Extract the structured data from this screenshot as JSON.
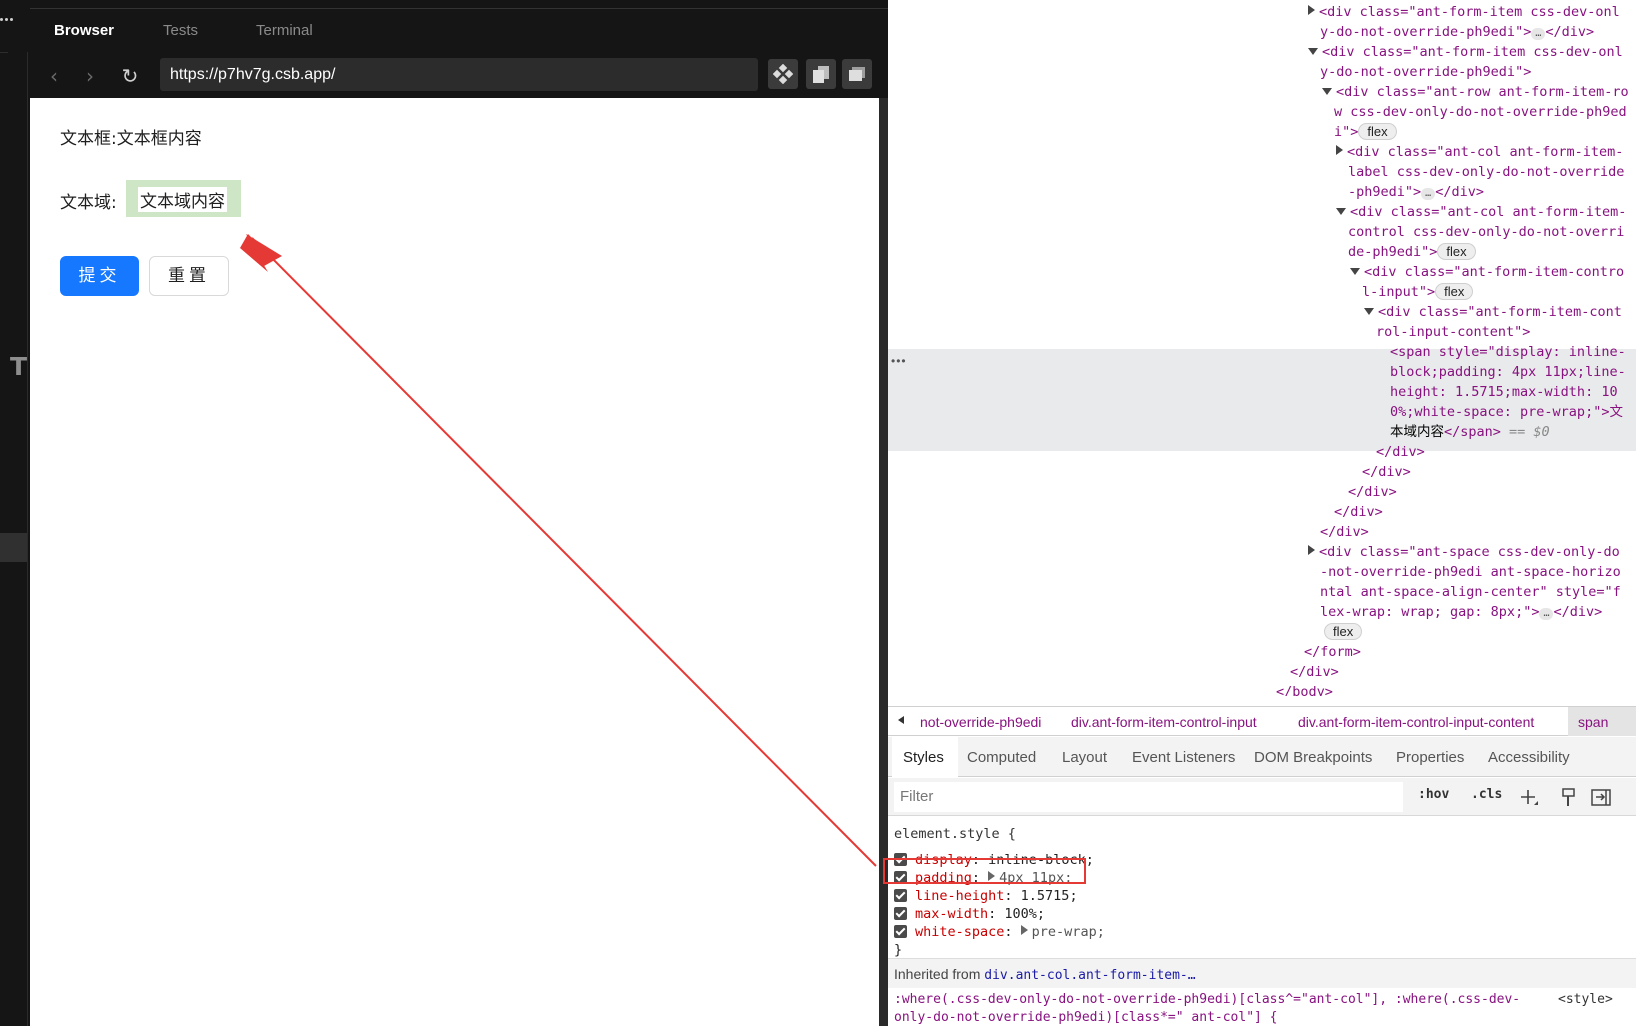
{
  "browser": {
    "tabs": [
      "Browser",
      "Tests",
      "Terminal"
    ],
    "url": "https://p7hv7g.csb.app/",
    "sidebar_letter": "T"
  },
  "form": {
    "input_label": "文本框:",
    "input_value": "文本框内容",
    "textarea_label": "文本域:",
    "textarea_value": "文本域内容",
    "submit_label": "提交",
    "reset_label": "重置"
  },
  "devtools": {
    "dom": {
      "l1a": "<div class=\"ant-form-item css-dev-onl",
      "l1b": "y-do-not-override-ph9edi\">",
      "l1c": "</div>",
      "l2a": "<div class=\"ant-form-item css-dev-onl",
      "l2b": "y-do-not-override-ph9edi\">",
      "l3a": "<div class=\"ant-row ant-form-item-ro",
      "l3b": "w css-dev-only-do-not-override-ph9ed",
      "l3c": "i\">",
      "l4a": "<div class=\"ant-col ant-form-item-",
      "l4b": "label css-dev-only-do-not-override",
      "l4c": "-ph9edi\">",
      "l4d": "</div>",
      "l5a": "<div class=\"ant-col ant-form-item-",
      "l5b": "control css-dev-only-do-not-overri",
      "l5c": "de-ph9edi\">",
      "l6a": "<div class=\"ant-form-item-contro",
      "l6b": "l-input\">",
      "l7a": "<div class=\"ant-form-item-cont",
      "l7b": "rol-input-content\">",
      "l8a": "<span style=\"display: inline-",
      "l8b": "block;padding: 4px 11px;line-",
      "l8c": "height: 1.5715;max-width: 10",
      "l8d": "0%;white-space: pre-wrap;\">文",
      "l8e": "本域内容",
      "l8f": "</span>",
      "eq0": "== $0",
      "close1": "</div>",
      "close2": "</div>",
      "close3": "</div>",
      "close4": "</div>",
      "close5": "</div>",
      "l9a": "<div class=\"ant-space css-dev-only-do",
      "l9b": "-not-override-ph9edi ant-space-horizo",
      "l9c": "ntal ant-space-align-center\" style=\"f",
      "l9d": "lex-wrap: wrap; gap: 8px;\">",
      "l9e": "</div>",
      "form_close": "</form>",
      "div_close": "</div>",
      "body_close": "</body>",
      "flex": "flex",
      "ellipsis": "…",
      "sel_dots": "•••"
    },
    "breadcrumbs": [
      "not-override-ph9edi",
      "div.ant-form-item-control-input",
      "div.ant-form-item-control-input-content",
      "span"
    ],
    "style_tabs": [
      "Styles",
      "Computed",
      "Layout",
      "Event Listeners",
      "DOM Breakpoints",
      "Properties",
      "Accessibility"
    ],
    "filter_placeholder": "Filter",
    "hov": ":hov",
    "cls": ".cls",
    "element_style": "element.style {",
    "props": [
      {
        "name": "display",
        "value": "inline-block;"
      },
      {
        "name": "padding",
        "value": "4px 11px;"
      },
      {
        "name": "line-height",
        "value": "1.5715;"
      },
      {
        "name": "max-width",
        "value": "100%;"
      },
      {
        "name": "white-space",
        "value": "pre-wrap;"
      }
    ],
    "close_brace": "}",
    "inherited_from": "Inherited from",
    "inherited_sel": "div.ant-col.ant-form-item-…",
    "rule1": ":where(.css-dev-only-do-not-override-ph9edi)[class^=\"ant-col\"], :where(.css-dev-",
    "rule1_src": "<style>",
    "rule2": "only-do-not-override-ph9edi)[class*=\" ant-col\"] {"
  },
  "colors": {
    "primary": "#1677ff",
    "highlight_fill": "#cfe6c6",
    "annotation_red": "#e53935"
  }
}
